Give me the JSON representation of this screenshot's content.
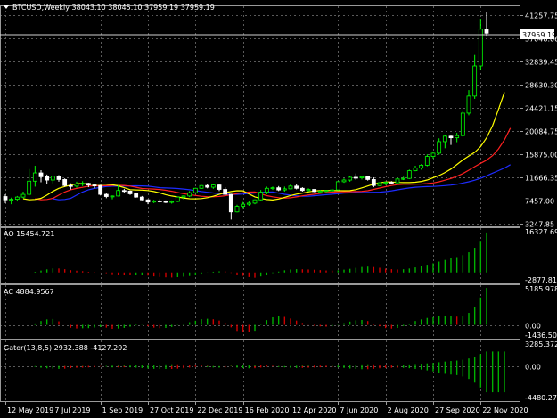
{
  "title_bar": {
    "symbol_line": "BTCUSD,Weekly  38043.10 38045.10 37959.19 37959.19"
  },
  "colors": {
    "background": "#000000",
    "bull_candle": "#00ff00",
    "bear_candle": "#ffffff",
    "ma_fast": "#ffff00",
    "ma_mid": "#ff2020",
    "ma_slow": "#1e2cff",
    "osc_up": "#00b000",
    "osc_down": "#d00000"
  },
  "chart_data": [
    {
      "type": "candlestick",
      "panel": "main",
      "yticks": [
        "41257.75",
        "37048.06",
        "32839.45",
        "28630.30",
        "24421.15",
        "20084.75",
        "15875.00",
        "11666.35",
        "7457.00",
        "3247.85"
      ],
      "ylim": [
        3247.85,
        41257.75
      ],
      "current_price_label": "37959.19",
      "candles": [
        [
          8200,
          8600,
          7000,
          7600
        ],
        [
          7600,
          8000,
          6800,
          7700
        ],
        [
          7700,
          8300,
          7300,
          8100
        ],
        [
          8100,
          9100,
          7900,
          8600
        ],
        [
          8600,
          13200,
          8400,
          11000
        ],
        [
          11000,
          13800,
          10000,
          12500
        ],
        [
          12500,
          13000,
          10800,
          11800
        ],
        [
          11800,
          12200,
          10400,
          11200
        ],
        [
          11200,
          12000,
          10600,
          11900
        ],
        [
          11900,
          12100,
          10900,
          11300
        ],
        [
          11300,
          11500,
          10000,
          10200
        ],
        [
          10200,
          10600,
          9500,
          10100
        ],
        [
          10100,
          10900,
          9800,
          10500
        ],
        [
          10500,
          11000,
          10100,
          10600
        ],
        [
          10600,
          10700,
          9900,
          10300
        ],
        [
          10300,
          10400,
          9700,
          10200
        ],
        [
          10200,
          10300,
          8400,
          8600
        ],
        [
          8600,
          8900,
          7900,
          8200
        ],
        [
          8200,
          8400,
          7700,
          8300
        ],
        [
          8300,
          10300,
          8200,
          9300
        ],
        [
          9300,
          9600,
          8900,
          9200
        ],
        [
          9200,
          9300,
          8500,
          8700
        ],
        [
          8700,
          8800,
          8000,
          8100
        ],
        [
          8100,
          8300,
          7500,
          7600
        ],
        [
          7600,
          7700,
          6800,
          7200
        ],
        [
          7200,
          7600,
          7000,
          7400
        ],
        [
          7400,
          7700,
          7100,
          7300
        ],
        [
          7300,
          7500,
          7000,
          7200
        ],
        [
          7200,
          7500,
          6900,
          7300
        ],
        [
          7300,
          8200,
          7200,
          8100
        ],
        [
          8100,
          8400,
          7700,
          8300
        ],
        [
          8300,
          9200,
          8100,
          8900
        ],
        [
          8900,
          9800,
          8700,
          9700
        ],
        [
          9700,
          10300,
          9600,
          10200
        ],
        [
          10200,
          10500,
          9700,
          9900
        ],
        [
          9900,
          10400,
          9600,
          10300
        ],
        [
          10300,
          10500,
          9200,
          9500
        ],
        [
          9500,
          9900,
          8500,
          8600
        ],
        [
          8600,
          8700,
          4000,
          5400
        ],
        [
          5400,
          6700,
          5300,
          6400
        ],
        [
          6400,
          7200,
          6100,
          6800
        ],
        [
          6800,
          7300,
          6500,
          7000
        ],
        [
          7000,
          7700,
          6800,
          7600
        ],
        [
          7600,
          9400,
          7500,
          9000
        ],
        [
          9000,
          10000,
          8600,
          9700
        ],
        [
          9700,
          10000,
          9400,
          9800
        ],
        [
          9800,
          10100,
          9200,
          9400
        ],
        [
          9400,
          10000,
          9100,
          9600
        ],
        [
          9600,
          10400,
          9500,
          10100
        ],
        [
          10100,
          10400,
          9500,
          9700
        ],
        [
          9700,
          9900,
          9100,
          9300
        ],
        [
          9300,
          9700,
          9100,
          9500
        ],
        [
          9500,
          9500,
          9000,
          9100
        ],
        [
          9100,
          9400,
          9000,
          9200
        ],
        [
          9200,
          9400,
          9000,
          9300
        ],
        [
          9300,
          9600,
          9100,
          9400
        ],
        [
          9400,
          11000,
          9300,
          10900
        ],
        [
          10900,
          11500,
          10700,
          11200
        ],
        [
          11200,
          12000,
          10900,
          11700
        ],
        [
          11700,
          12400,
          11200,
          11600
        ],
        [
          11600,
          12000,
          11300,
          11800
        ],
        [
          11800,
          11900,
          11100,
          11300
        ],
        [
          11300,
          11700,
          9900,
          10200
        ],
        [
          10200,
          10800,
          10100,
          10700
        ],
        [
          10700,
          10900,
          10300,
          10800
        ],
        [
          10800,
          11000,
          10500,
          10700
        ],
        [
          10700,
          11600,
          10600,
          11400
        ],
        [
          11400,
          11800,
          11200,
          11500
        ],
        [
          11500,
          13100,
          11400,
          12900
        ],
        [
          12900,
          13800,
          12800,
          13400
        ],
        [
          13400,
          14100,
          13100,
          13900
        ],
        [
          13900,
          15900,
          13700,
          15500
        ],
        [
          15500,
          16400,
          15100,
          16100
        ],
        [
          16100,
          18800,
          15800,
          18200
        ],
        [
          18200,
          19400,
          17000,
          19200
        ],
        [
          19200,
          19300,
          17600,
          18900
        ],
        [
          18900,
          19800,
          18100,
          19300
        ],
        [
          19300,
          23900,
          19100,
          23400
        ],
        [
          23400,
          27600,
          23000,
          26500
        ],
        [
          26500,
          34000,
          26000,
          32000
        ],
        [
          32000,
          40600,
          31200,
          38700
        ],
        [
          38700,
          41900,
          37500,
          37959.19
        ]
      ],
      "indicators": [
        {
          "name": "MA fast",
          "period": 5,
          "color": "#ffff00"
        },
        {
          "name": "MA mid",
          "period": 8,
          "color": "#ff2020"
        },
        {
          "name": "MA slow",
          "period": 13,
          "color": "#1e2cff"
        }
      ],
      "x_tick_labels": [
        "12 May 2019",
        "7 Jul 2019",
        "1 Sep 2019",
        "27 Oct 2019",
        "22 Dec 2019",
        "16 Feb 2020",
        "12 Apr 2020",
        "7 Jun 2020",
        "2 Aug 2020",
        "27 Sep 2020",
        "22 Nov 2020"
      ],
      "xlim": [
        "12 May 2019",
        "3 Jan 2021"
      ]
    },
    {
      "type": "bar",
      "panel": "ao",
      "label": "AO 15454.721",
      "yticks": [
        "16327.699",
        "-2877.818"
      ],
      "ylim": [
        -2877.818,
        16327.699
      ]
    },
    {
      "type": "bar",
      "panel": "ac",
      "label": "AC 4884.9567",
      "yticks": [
        "5185.9789",
        "0.00",
        "-1436.5096"
      ],
      "ylim": [
        -1436.5096,
        5185.9789
      ]
    },
    {
      "type": "bar",
      "panel": "gator",
      "label": "Gator(13,8,5) 2932.388 -4127.292",
      "yticks": [
        "3285.372",
        "0.00",
        "-4480.276"
      ],
      "ylim": [
        -4480.276,
        3285.372
      ]
    }
  ]
}
